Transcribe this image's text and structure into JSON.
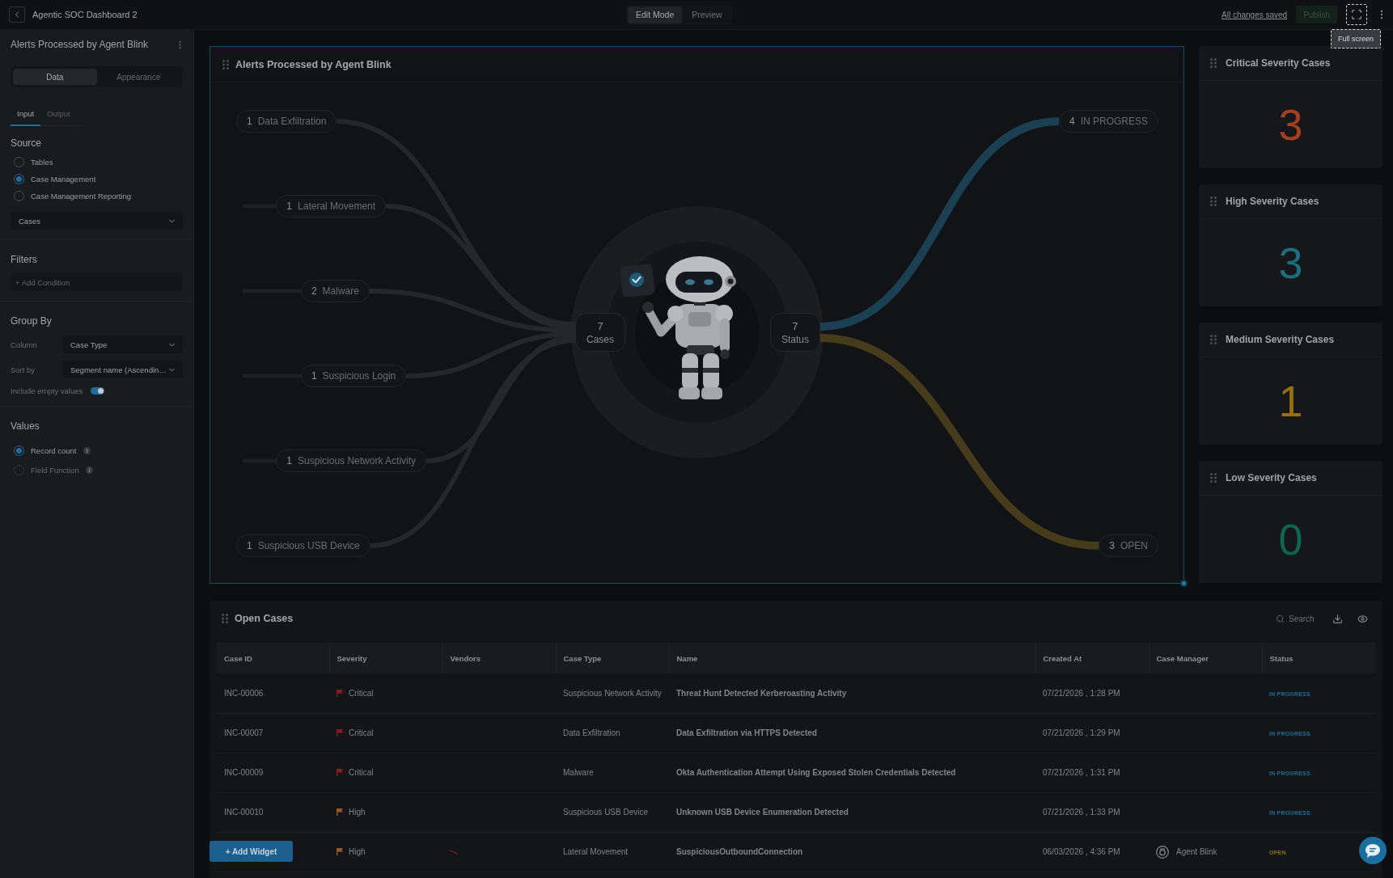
{
  "top_bar": {
    "title": "Agentic SOC Dashboard 2",
    "modes": [
      {
        "label": "Edit Mode",
        "selected": true
      },
      {
        "label": "Preview",
        "selected": false
      }
    ],
    "save_status": "All changes saved",
    "publish": {
      "label": "Publish",
      "disabled": true
    },
    "tooltip": "Full screen"
  },
  "editor": {
    "title": "Alerts Processed by Agent Blink",
    "view_tabs": [
      {
        "label": "Data",
        "selected": true
      },
      {
        "label": "Appearance",
        "selected": false
      }
    ],
    "sub_tabs": [
      {
        "label": "Input",
        "selected": true
      },
      {
        "label": "Output",
        "selected": false
      }
    ],
    "source": {
      "heading": "Source",
      "options": [
        {
          "label": "Tables",
          "selected": false
        },
        {
          "label": "Case Management",
          "selected": true
        },
        {
          "label": "Case Management Reporting",
          "selected": false
        }
      ],
      "table": "Cases"
    },
    "filters": {
      "heading": "Filters",
      "add_condition": "+ Add Condition"
    },
    "group_by": {
      "heading": "Group By",
      "fields": [
        {
          "label": "Column",
          "value": "Case Type"
        },
        {
          "label": "Sort by",
          "value": "Segment name (Ascendin…"
        }
      ],
      "include_empty": {
        "label": "Include empty values",
        "on": true
      }
    },
    "values": {
      "heading": "Values",
      "options": [
        {
          "label": "Record count",
          "selected": true,
          "disabled": false
        },
        {
          "label": "Field Function",
          "selected": false,
          "disabled": true
        }
      ]
    }
  },
  "flow_widget": {
    "title": "Alerts Processed by Agent Blink",
    "selected": true,
    "sources": [
      {
        "count": "1",
        "label": "Data Exfiltration"
      },
      {
        "count": "1",
        "label": "Lateral Movement"
      },
      {
        "count": "2",
        "label": "Malware"
      },
      {
        "count": "1",
        "label": "Suspicious Login"
      },
      {
        "count": "1",
        "label": "Suspicious Network Activity"
      },
      {
        "count": "1",
        "label": "Suspicious USB Device"
      }
    ],
    "hubs": [
      {
        "count": "7",
        "label": "Cases"
      },
      {
        "count": "7",
        "label": "Status"
      }
    ],
    "targets": [
      {
        "count": "4",
        "label": "IN PROGRESS",
        "color": "#1b4054"
      },
      {
        "count": "3",
        "label": "OPEN",
        "color": "#463c1c"
      }
    ]
  },
  "stat_cards": [
    {
      "title": "Critical Severity Cases",
      "value": "3",
      "color": "#a3401f"
    },
    {
      "title": "High Severity Cases",
      "value": "3",
      "color": "#1b6e7c"
    },
    {
      "title": "Medium Severity Cases",
      "value": "1",
      "color": "#94700e"
    },
    {
      "title": "Low Severity Cases",
      "value": "0",
      "color": "#0f6650"
    }
  ],
  "table_widget": {
    "title": "Open Cases",
    "search": {
      "placeholder": "Search"
    },
    "columns": [
      "Case ID",
      "Severity",
      "Vendors",
      "Case Type",
      "Name",
      "Created At",
      "Case Manager",
      "Status"
    ],
    "rows": [
      {
        "case_id": "INC-00006",
        "severity": {
          "label": "Critical",
          "color": "#8e1b1b"
        },
        "vendor_logo": false,
        "case_type": "Suspicious Network Activity",
        "name": "Threat Hunt Detected Kerberoasting Activity",
        "created_at": "07/21/2026 , 1:28 PM",
        "status": {
          "label": "IN PROGRESS",
          "color": "#1f6d95"
        }
      },
      {
        "case_id": "INC-00007",
        "severity": {
          "label": "Critical",
          "color": "#8e1b1b"
        },
        "vendor_logo": false,
        "case_type": "Data Exfiltration",
        "name": "Data Exfiltration via HTTPS Detected",
        "created_at": "07/21/2026 , 1:29 PM",
        "status": {
          "label": "IN PROGRESS",
          "color": "#1f6d95"
        }
      },
      {
        "case_id": "INC-00009",
        "severity": {
          "label": "Critical",
          "color": "#8e1b1b"
        },
        "vendor_logo": false,
        "case_type": "Malware",
        "name": "Okta Authentication Attempt Using Exposed Stolen Credentials Detected",
        "created_at": "07/21/2026 , 1:31 PM",
        "status": {
          "label": "IN PROGRESS",
          "color": "#1f6d95"
        }
      },
      {
        "case_id": "INC-00010",
        "severity": {
          "label": "High",
          "color": "#9a5a1e"
        },
        "vendor_logo": false,
        "case_type": "Suspicious USB Device",
        "name": "Unknown USB Device Enumeration Detected",
        "created_at": "07/21/2026 , 1:33 PM",
        "status": {
          "label": "IN PROGRESS",
          "color": "#1f6d95"
        }
      },
      {
        "severity": {
          "label": "High",
          "color": "#9a5a1e"
        },
        "vendor_logo": true,
        "case_type": "Lateral Movement",
        "name": "SuspiciousOutboundConnection",
        "created_at": "06/03/2026 , 4:36 PM",
        "case_manager": "Agent Blink",
        "status": {
          "label": "OPEN",
          "color": "#8f6d12"
        }
      }
    ]
  },
  "add_widget": "+ Add Widget"
}
